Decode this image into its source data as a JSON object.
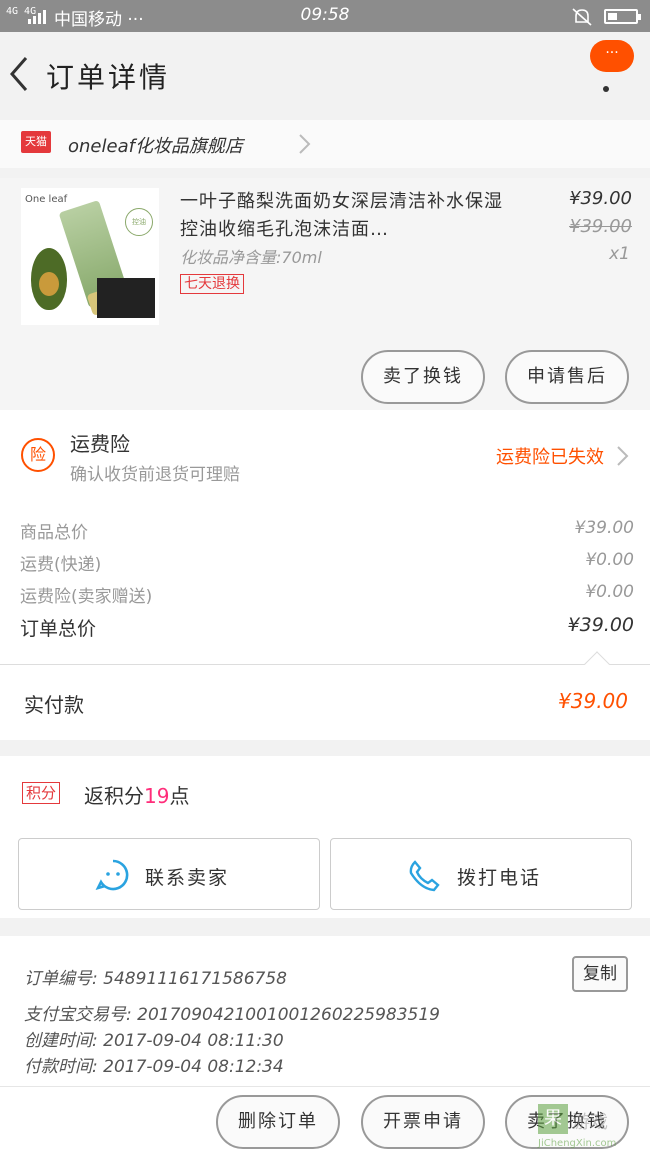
{
  "status_bar": {
    "signal_text": "4G 4G",
    "carrier": "中国移动 ···",
    "time": "09:58",
    "battery_level": 0.35
  },
  "nav": {
    "title": "订单详情",
    "more_badge": "···"
  },
  "shop": {
    "badge": "天猫",
    "name": "oneleaf化妆品旗舰店"
  },
  "product": {
    "image_brand": "One leaf",
    "image_seal": "控油",
    "title": "一叶子酪梨洗面奶女深层清洁补水保湿控油收缩毛孔泡沫洁面…",
    "spec": "化妆品净含量:70ml",
    "tag": "七天退换",
    "price": "¥39.00",
    "original_price": "¥39.00",
    "quantity": "x1",
    "actions": [
      "卖了换钱",
      "申请售后"
    ]
  },
  "insurance": {
    "icon": "险",
    "title": "运费险",
    "subtitle": "确认收货前退货可理赔",
    "status": "运费险已失效"
  },
  "costs": [
    {
      "label": "商品总价",
      "value": "¥39.00"
    },
    {
      "label": "运费(快递)",
      "value": "¥0.00"
    },
    {
      "label": "运费险(卖家赠送)",
      "value": "¥0.00"
    },
    {
      "label": "订单总价",
      "value": "¥39.00"
    }
  ],
  "paid": {
    "label": "实付款",
    "value": "¥39.00"
  },
  "points": {
    "badge": "积分",
    "prefix": "返积分",
    "count": "19",
    "suffix": "点"
  },
  "contact": {
    "seller": "联系卖家",
    "call": "拨打电话"
  },
  "order_info": {
    "order_no": "订单编号: 548911161715867​58",
    "alipay_no": "支付宝交易号: 2017090421001001260225983519",
    "created": "创建时间: 2017-09-04 08:11:30",
    "paid": "付款时间: 2017-09-04 08:12:34",
    "copy_label": "复制"
  },
  "bottom_actions": [
    "删除订单",
    "开票申请",
    "卖了换钱"
  ],
  "watermark": {
    "char": "果",
    "text": "游戏",
    "url": "JiChengXin.com"
  },
  "colors": {
    "accent": "#ff5000",
    "tmall_red": "#e4393c",
    "points_pink": "#ff2d7a"
  }
}
